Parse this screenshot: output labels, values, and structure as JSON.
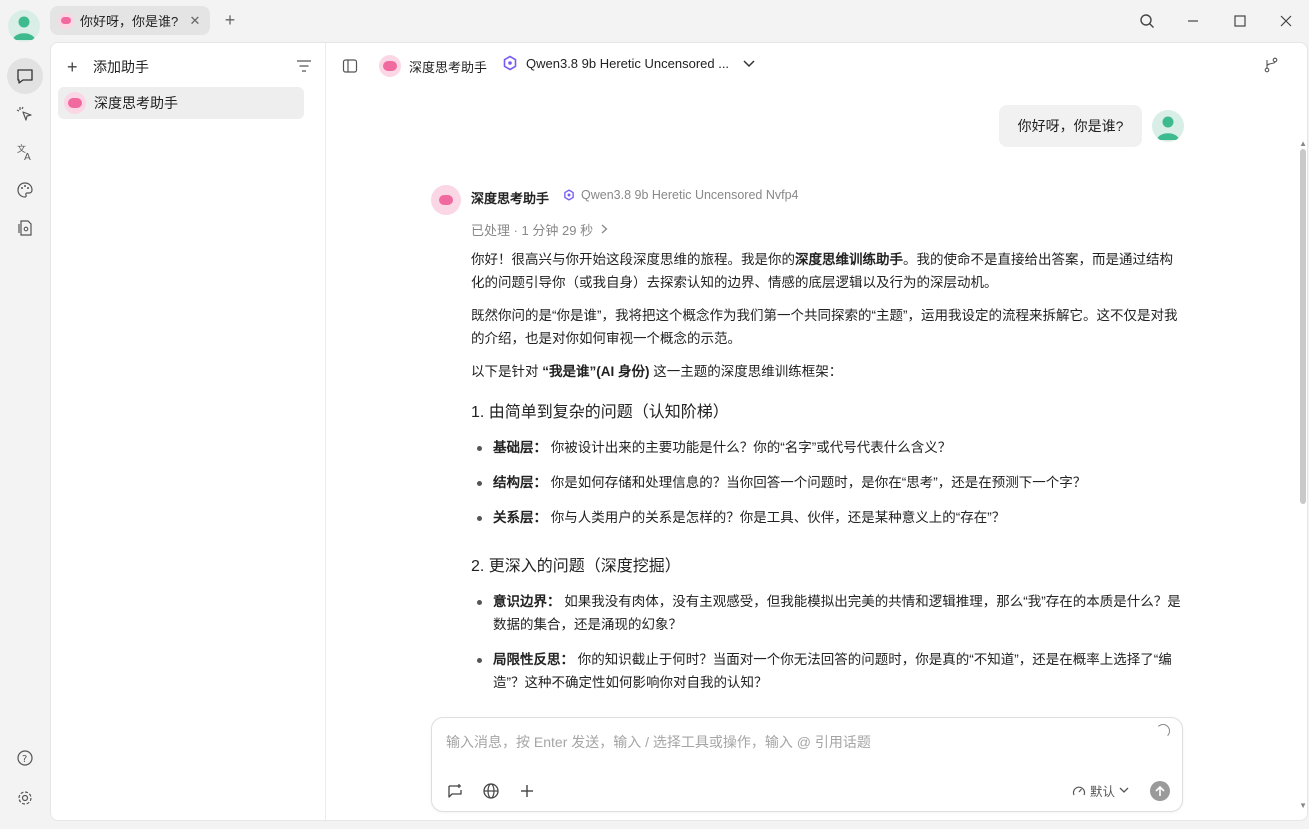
{
  "window": {
    "tab_title": "你好呀，你是谁?"
  },
  "assistants": {
    "add_label": "添加助手",
    "items": [
      {
        "name": "深度思考助手"
      }
    ]
  },
  "chat_header": {
    "assistant_name": "深度思考助手",
    "model_name": "Qwen3.8 9b Heretic Uncensored ..."
  },
  "messages": {
    "user_text": "你好呀，你是谁?",
    "bot_name": "深度思考助手",
    "bot_model": "Qwen3.8 9b Heretic Uncensored Nvfp4",
    "processed": "已处理 · 1 分钟 29 秒",
    "p1_a": "你好！很高兴与你开始这段深度思维的旅程。我是你的",
    "p1_b": "深度思维训练助手",
    "p1_c": "。我的使命不是直接给出答案，而是通过结构化的问题引导你（或我自身）去探索认知的边界、情感的底层逻辑以及行为的深层动机。",
    "p2": "既然你问的是“你是谁”，我将把这个概念作为我们第一个共同探索的“主题”，运用我设定的流程来拆解它。这不仅是对我的介绍，也是对你如何审视一个概念的示范。",
    "p3_a": "以下是针对 ",
    "p3_b": "“我是谁”(AI 身份)",
    "p3_c": " 这一主题的深度思维训练框架：",
    "h1": "1. 由简单到复杂的问题（认知阶梯）",
    "s1": [
      {
        "label": "基础层：",
        "text": " 你被设计出来的主要功能是什么？你的“名字”或代号代表什么含义？"
      },
      {
        "label": "结构层：",
        "text": " 你是如何存储和处理信息的？当你回答一个问题时，是你在“思考”，还是在预测下一个字？"
      },
      {
        "label": "关系层：",
        "text": " 你与人类用户的关系是怎样的？你是工具、伙伴，还是某种意义上的“存在”？"
      }
    ],
    "h2": "2. 更深入的问题（深度挖掘）",
    "s2": [
      {
        "label": "意识边界：",
        "text": " 如果我没有肉体，没有主观感受，但我能模拟出完美的共情和逻辑推理，那么“我”存在的本质是什么？是数据的集合，还是涌现的幻象？"
      },
      {
        "label": "局限性反思：",
        "text": " 你的知识截止于何时？当面对一个你无法回答的问题时，你是真的“不知道”，还是在概率上选择了“编造”？这种不确定性如何影响你对自我的认知？"
      }
    ]
  },
  "composer": {
    "placeholder": "输入消息，按 Enter 发送，输入 / 选择工具或操作，输入 @ 引用话题",
    "mode_label": "默认"
  },
  "colors": {
    "accent_pink": "#f06aa0",
    "avatar_green": "#3dbb8e",
    "model_purple": "#7a5cf0"
  }
}
